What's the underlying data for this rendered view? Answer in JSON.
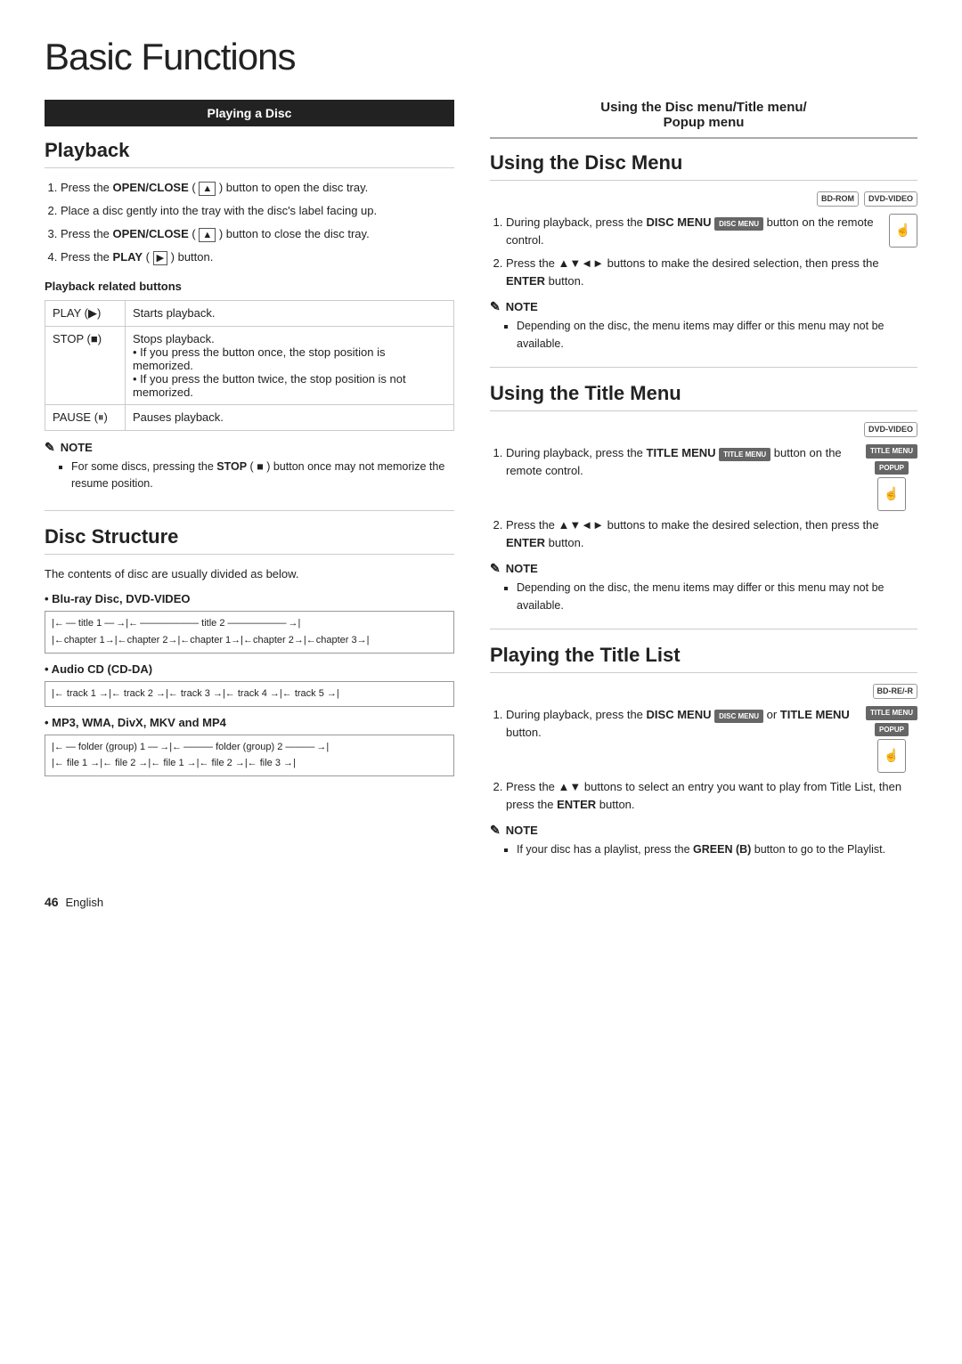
{
  "page": {
    "title": "Basic Functions",
    "footer": "46",
    "footer_lang": "English"
  },
  "left_header": "Playing a Disc",
  "right_header_line1": "Using the Disc menu/Title menu/",
  "right_header_line2": "Popup menu",
  "playback": {
    "heading": "Playback",
    "steps": [
      {
        "num": "1.",
        "text_before": "Press the ",
        "bold": "OPEN/CLOSE",
        "text_mid": " (",
        "icon": "▲",
        "text_after": " ) button to open the disc tray."
      },
      {
        "num": "2.",
        "text": "Place a disc gently into the tray with the disc's label facing up."
      },
      {
        "num": "3.",
        "text_before": "Press the ",
        "bold": "OPEN/CLOSE",
        "text_mid": " (",
        "icon": "▲",
        "text_after": " ) button to close the disc tray."
      },
      {
        "num": "4.",
        "text_before": "Press the ",
        "bold": "PLAY",
        "text_mid": " (",
        "icon": "▶",
        "text_after": " ) button."
      }
    ],
    "related_heading": "Playback related buttons",
    "table": [
      {
        "col1": "PLAY (▶)",
        "col2": "Starts playback."
      },
      {
        "col1": "STOP (■)",
        "col2_items": [
          "Stops playback.",
          "• If you press the button once, the stop position is memorized.",
          "• If you press the button twice, the stop position is not memorized."
        ]
      },
      {
        "col1": "PAUSE (⏸)",
        "col2": "Pauses playback."
      }
    ],
    "note_title": "NOTE",
    "note_items": [
      {
        "text_before": "For some discs, pressing the ",
        "bold": "STOP",
        "text_icon": " (■)",
        "text_after": " button once may not memorize the resume position."
      }
    ]
  },
  "disc_structure": {
    "heading": "Disc Structure",
    "intro": "The contents of disc are usually divided as below.",
    "items": [
      {
        "label": "• Blu-ray Disc, DVD-VIDEO",
        "rows": [
          {
            "type": "title",
            "items": [
              "title 1",
              "title 2"
            ]
          },
          {
            "type": "chapter",
            "items": [
              "chapter 1",
              "chapter 2",
              "chapter 1",
              "chapter 2",
              "chapter 3"
            ]
          }
        ]
      },
      {
        "label": "• Audio CD (CD-DA)",
        "rows": [
          {
            "type": "track",
            "items": [
              "track 1",
              "track 2",
              "track 3",
              "track 4",
              "track 5"
            ]
          }
        ]
      },
      {
        "label": "• MP3, WMA, DivX, MKV and MP4",
        "rows": [
          {
            "type": "folder",
            "items": [
              "folder (group) 1",
              "folder (group) 2"
            ]
          },
          {
            "type": "file",
            "items": [
              "file 1",
              "file 2",
              "file 1",
              "file 2",
              "file 3"
            ]
          }
        ]
      }
    ]
  },
  "disc_menu": {
    "heading": "Using the Disc Menu",
    "badges": [
      "BD-ROM",
      "DVD-VIDEO"
    ],
    "steps": [
      {
        "num": "1.",
        "text_before": "During playback, press the ",
        "bold": "DISC MENU",
        "text_after": " button on the remote control.",
        "badge": "DISC MENU"
      },
      {
        "num": "2.",
        "text_before": "Press the ▲▼◄► buttons to make the desired selection, then press the ",
        "bold": "ENTER",
        "text_after": " button."
      }
    ],
    "note_title": "NOTE",
    "note_items": [
      "Depending on the disc, the menu items may differ or this menu may not be available."
    ]
  },
  "title_menu": {
    "heading": "Using the Title Menu",
    "badges": [
      "DVD-VIDEO"
    ],
    "steps": [
      {
        "num": "1.",
        "text_before": "During playback, press the ",
        "bold": "TITLE MENU",
        "text_after": " button on the remote control.",
        "badges": [
          "TITLE MENU",
          "POPUP"
        ]
      },
      {
        "num": "2.",
        "text_before": "Press the ▲▼◄► buttons to make the desired selection, then press the ",
        "bold": "ENTER",
        "text_after": " button."
      }
    ],
    "note_title": "NOTE",
    "note_items": [
      "Depending on the disc, the menu items may differ or this menu may not be available."
    ]
  },
  "title_list": {
    "heading": "Playing the Title List",
    "badges": [
      "BD-RE/-R"
    ],
    "steps": [
      {
        "num": "1.",
        "text_before": "During playback, press the ",
        "bold": "DISC MENU",
        "text_after": " or ",
        "bold2": "TITLE MENU",
        "text_after2": " button.",
        "badges": [
          "DISC MENU",
          "TITLE MENU",
          "POPUP"
        ]
      },
      {
        "num": "2.",
        "text_before": "Press the ▲▼ buttons to select an entry you want to play from Title List, then press the ",
        "bold": "ENTER",
        "text_after": " button."
      }
    ],
    "note_title": "NOTE",
    "note_items": [
      {
        "text_before": "If your disc has a playlist, press the ",
        "bold": "GREEN (B)",
        "text_after": " button to go to the Playlist."
      }
    ]
  }
}
